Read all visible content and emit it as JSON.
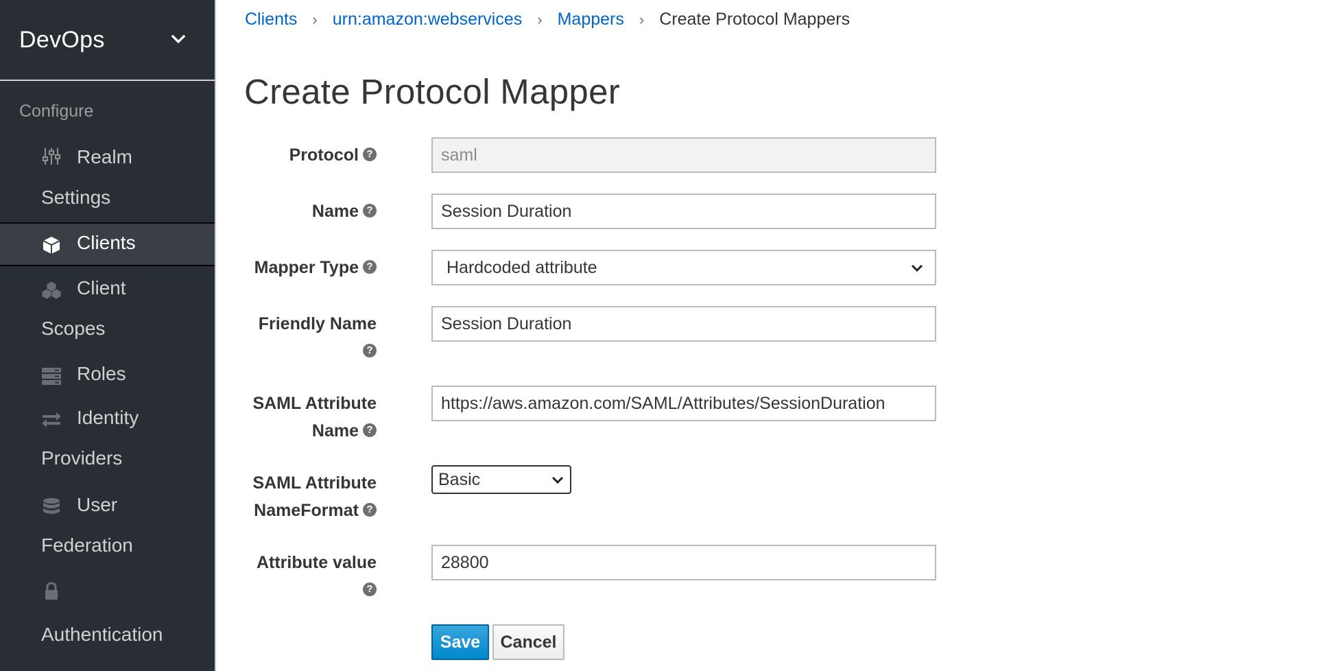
{
  "sidebar": {
    "realm": "DevOps",
    "section": "Configure",
    "items": [
      {
        "line1": "Realm",
        "line2": "Settings",
        "icon": "sliders-icon"
      },
      {
        "line1": "Clients",
        "line2": "",
        "icon": "cube-icon"
      },
      {
        "line1": "Client",
        "line2": "Scopes",
        "icon": "cubes-icon"
      },
      {
        "line1": "Roles",
        "line2": "",
        "icon": "server-icon"
      },
      {
        "line1": "Identity",
        "line2": "Providers",
        "icon": "exchange-icon"
      },
      {
        "line1": "User",
        "line2": "Federation",
        "icon": "database-icon"
      },
      {
        "line1": "",
        "line2": "Authentication",
        "icon": "lock-icon"
      }
    ]
  },
  "breadcrumb": {
    "items": [
      "Clients",
      "urn:amazon:webservices",
      "Mappers"
    ],
    "current": "Create Protocol Mappers"
  },
  "page_title": "Create Protocol Mapper",
  "form": {
    "protocol": {
      "label": "Protocol",
      "value": "saml"
    },
    "name": {
      "label": "Name",
      "value": "Session Duration"
    },
    "mapper_type": {
      "label": "Mapper Type",
      "value": "Hardcoded attribute"
    },
    "friendly_name": {
      "label": "Friendly Name",
      "value": "Session Duration"
    },
    "saml_attribute_name": {
      "label_line1": "SAML Attribute",
      "label_line2": "Name",
      "value": "https://aws.amazon.com/SAML/Attributes/SessionDuration"
    },
    "saml_attribute_nameformat": {
      "label_line1": "SAML Attribute",
      "label_line2": "NameFormat",
      "value": "Basic"
    },
    "attribute_value": {
      "label": "Attribute value",
      "value": "28800"
    }
  },
  "buttons": {
    "save": "Save",
    "cancel": "Cancel"
  },
  "help_glyph": "?",
  "breadcrumb_separator": "›",
  "colors": {
    "sidebar_bg": "#292e34",
    "link": "#0066cc",
    "primary": "#0088ce"
  }
}
